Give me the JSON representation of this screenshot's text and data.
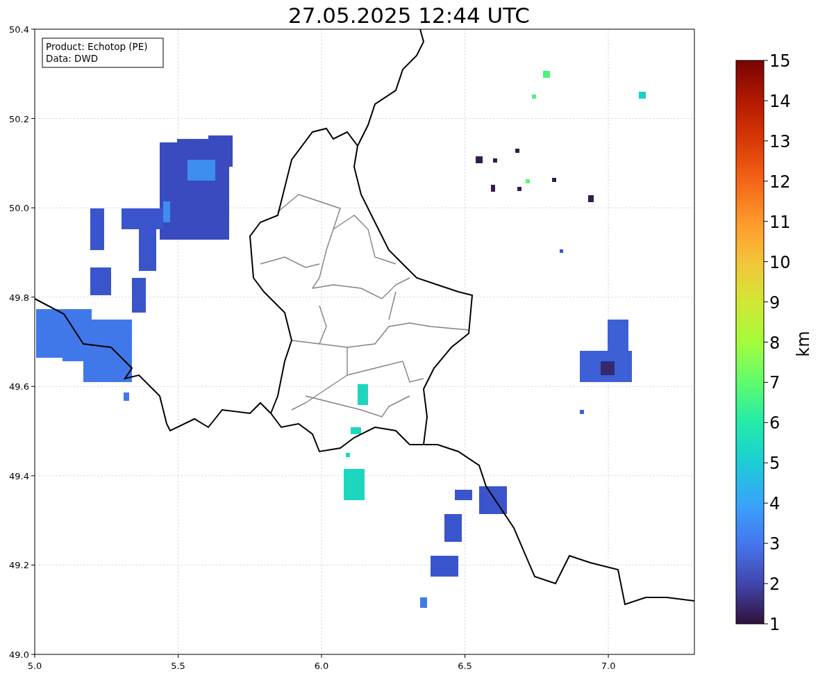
{
  "title": "27.05.2025 12:44 UTC",
  "info_box": [
    "Product: Echotop (PE)",
    "Data: DWD"
  ],
  "x_ticks": [
    "5.0",
    "5.5",
    "6.0",
    "6.5",
    "7.0"
  ],
  "y_ticks": [
    "50.4",
    "50.2",
    "50.0",
    "49.8",
    "49.6",
    "49.4",
    "49.2",
    "49.0"
  ],
  "colorbar": {
    "label": "km",
    "ticks": [
      "15",
      "14",
      "13",
      "12",
      "11",
      "10",
      "9",
      "8",
      "7",
      "6",
      "5",
      "4",
      "3",
      "2",
      "1"
    ]
  }
}
